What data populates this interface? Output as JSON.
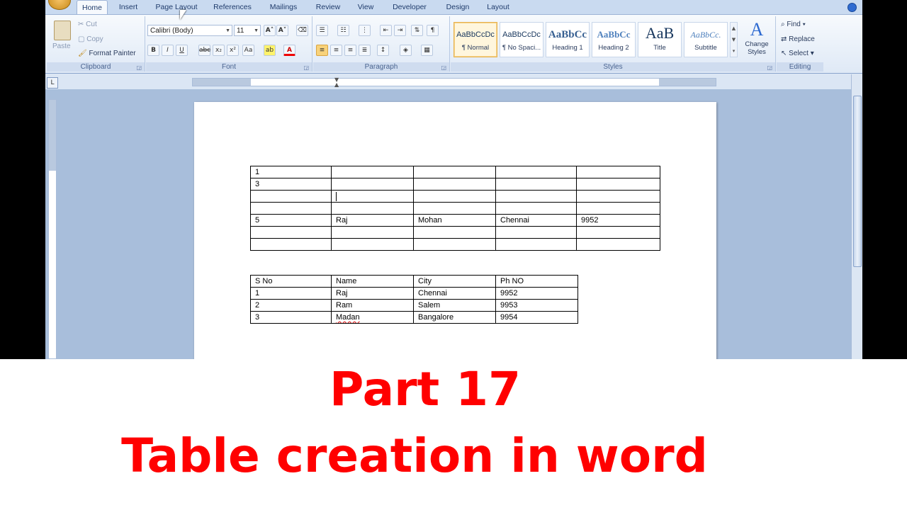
{
  "tabs": [
    "Home",
    "Insert",
    "Page Layout",
    "References",
    "Mailings",
    "Review",
    "View",
    "Developer",
    "Design",
    "Layout"
  ],
  "active_tab": "Home",
  "clipboard": {
    "paste": "Paste",
    "cut": "Cut",
    "copy": "Copy",
    "format_painter": "Format Painter",
    "label": "Clipboard"
  },
  "font": {
    "family": "Calibri (Body)",
    "size": "11",
    "label": "Font"
  },
  "paragraph": {
    "label": "Paragraph"
  },
  "styles": {
    "items": [
      {
        "sample": "AaBbCcDc",
        "name": "¶ Normal"
      },
      {
        "sample": "AaBbCcDc",
        "name": "¶ No Spaci..."
      },
      {
        "sample": "AaBbCc",
        "name": "Heading 1"
      },
      {
        "sample": "AaBbCc",
        "name": "Heading 2"
      },
      {
        "sample": "AaB",
        "name": "Title"
      },
      {
        "sample": "AaBbCc.",
        "name": "Subtitle"
      }
    ],
    "change_styles": "Change Styles",
    "label": "Styles"
  },
  "editing": {
    "find": "Find",
    "replace": "Replace",
    "select": "Select",
    "label": "Editing"
  },
  "table1": [
    [
      "1",
      "",
      "",
      "",
      ""
    ],
    [
      "3",
      "",
      "",
      "",
      ""
    ],
    [
      "",
      "",
      "",
      "",
      ""
    ],
    [
      "",
      "",
      "",
      "",
      ""
    ],
    [
      "5",
      "Raj",
      "Mohan",
      "Chennai",
      "9952"
    ],
    [
      "",
      "",
      "",
      "",
      ""
    ],
    [
      "",
      "",
      "",
      "",
      ""
    ]
  ],
  "table2": {
    "header": [
      "S No",
      "Name",
      "City",
      "Ph NO"
    ],
    "rows": [
      [
        "1",
        "Raj",
        "Chennai",
        "9952"
      ],
      [
        "2",
        "Ram",
        "Salem",
        "9953"
      ],
      [
        "3",
        "Madan",
        "Bangalore",
        "9954"
      ]
    ]
  },
  "caption": {
    "line1": "Part 17",
    "line2": "Table creation in word"
  }
}
